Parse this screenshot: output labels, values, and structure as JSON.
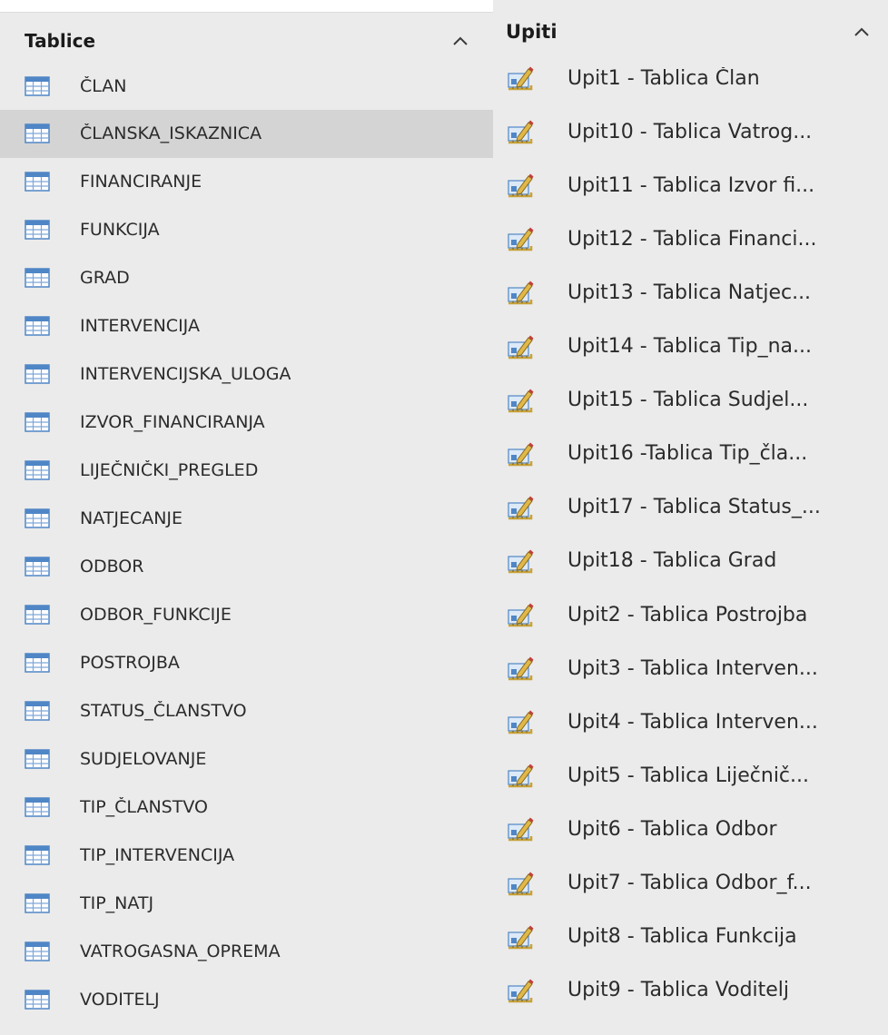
{
  "tables_group": {
    "title": "Tablice",
    "collapse_icon": "chevron-up-icon",
    "item_icon": "table-icon",
    "selected_index": 1,
    "items": [
      "ČLAN",
      "ČLANSKA_ISKAZNICA",
      "FINANCIRANJE",
      "FUNKCIJA",
      "GRAD",
      "INTERVENCIJA",
      "INTERVENCIJSKA_ULOGA",
      "IZVOR_FINANCIRANJA",
      "LIJEČNIČKI_PREGLED",
      "NATJECANJE",
      "ODBOR",
      "ODBOR_FUNKCIJE",
      "POSTROJBA",
      "STATUS_ČLANSTVO",
      "SUDJELOVANJE",
      "TIP_ČLANSTVO",
      "TIP_INTERVENCIJA",
      "TIP_NATJ",
      "VATROGASNA_OPREMA",
      "VODITELJ"
    ]
  },
  "queries_group": {
    "title": "Upiti",
    "collapse_icon": "chevron-up-icon",
    "item_icon": "query-design-icon",
    "items": [
      "Upit1 - Tablica Član",
      "Upit10 - Tablica Vatrog...",
      "Upit11 - Tablica Izvor fi...",
      "Upit12 - Tablica Financi...",
      "Upit13 - Tablica Natjec...",
      "Upit14 - Tablica Tip_na...",
      "Upit15 - Tablica Sudjel...",
      "Upit16 -Tablica Tip_čla...",
      "Upit17 - Tablica Status_...",
      "Upit18 - Tablica Grad",
      "Upit2 - Tablica Postrojba",
      "Upit3 - Tablica Interven...",
      "Upit4 - Tablica Interven...",
      "Upit5 - Tablica Liječnič...",
      "Upit6 - Tablica Odbor",
      "Upit7 - Tablica Odbor_f...",
      "Upit8 - Tablica Funkcija",
      "Upit9 - Tablica Voditelj"
    ]
  },
  "colors": {
    "pane_background": "#ebebeb",
    "selected_row": "#d4d4d4",
    "text": "#2b2b2b",
    "table_icon_blue": "#4f86c6",
    "query_icon_gold": "#c8a23a"
  }
}
